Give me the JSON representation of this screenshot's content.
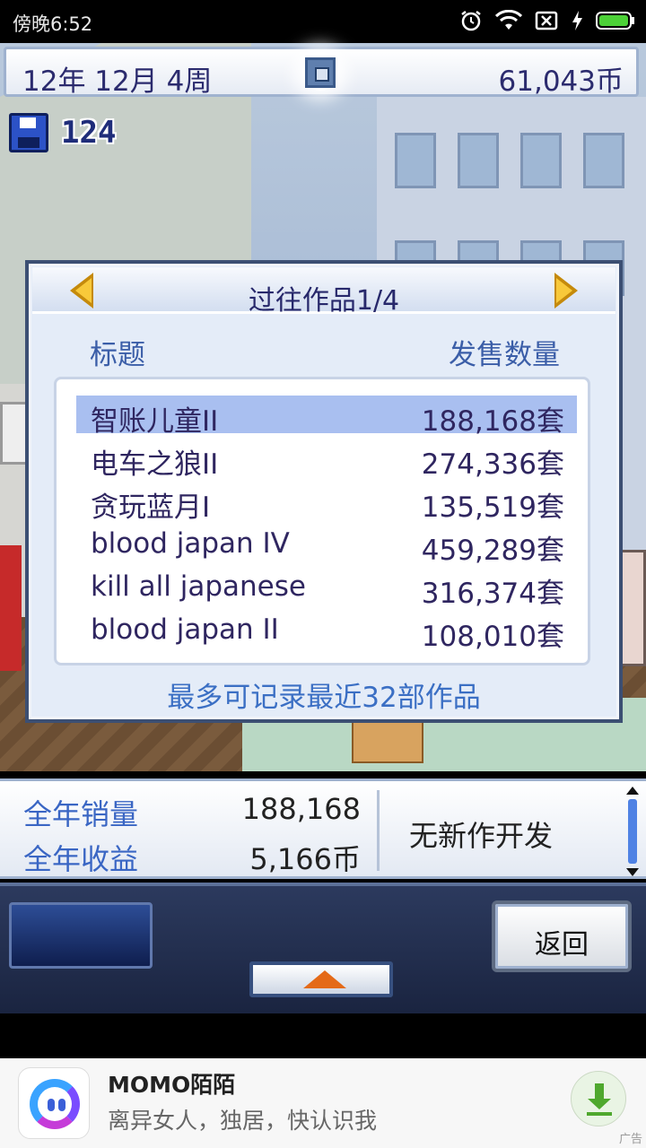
{
  "status_bar": {
    "time": "傍晚6:52",
    "icons": [
      "alarm-icon",
      "wifi-icon",
      "no-sim-icon",
      "charging-icon",
      "battery-icon"
    ]
  },
  "top_bar": {
    "date": "12年 12月 4周",
    "money": "61,043币"
  },
  "save_counter": {
    "value": "124"
  },
  "past_works": {
    "title": "过往作品1/4",
    "col_title": "标题",
    "col_sales": "发售数量",
    "rows": [
      {
        "title": "智账儿童II",
        "sales": "188,168套",
        "selected": true
      },
      {
        "title": "电车之狼II",
        "sales": "274,336套",
        "selected": false
      },
      {
        "title": "贪玩蓝月I",
        "sales": "135,519套",
        "selected": false
      },
      {
        "title": "blood japan IV",
        "sales": "459,289套",
        "selected": false
      },
      {
        "title": "kill all japanese",
        "sales": "316,374套",
        "selected": false
      },
      {
        "title": "blood japan II",
        "sales": "108,010套",
        "selected": false
      }
    ],
    "footer": "最多可记录最近32部作品"
  },
  "stats": {
    "annual_sales_label": "全年销量",
    "annual_sales_value": "188,168",
    "annual_income_label": "全年收益",
    "annual_income_value": "5,166币",
    "dev_status": "无新作开发"
  },
  "controls": {
    "back_label": "返回"
  },
  "ad": {
    "title": "MOMO陌陌",
    "description": "离异女人，独居，快认识我",
    "tag": "广告"
  },
  "colors": {
    "accent_text": "#3a66c4",
    "dialog_bg": "#e4ecf8",
    "selected_row": "#a9bff0"
  }
}
